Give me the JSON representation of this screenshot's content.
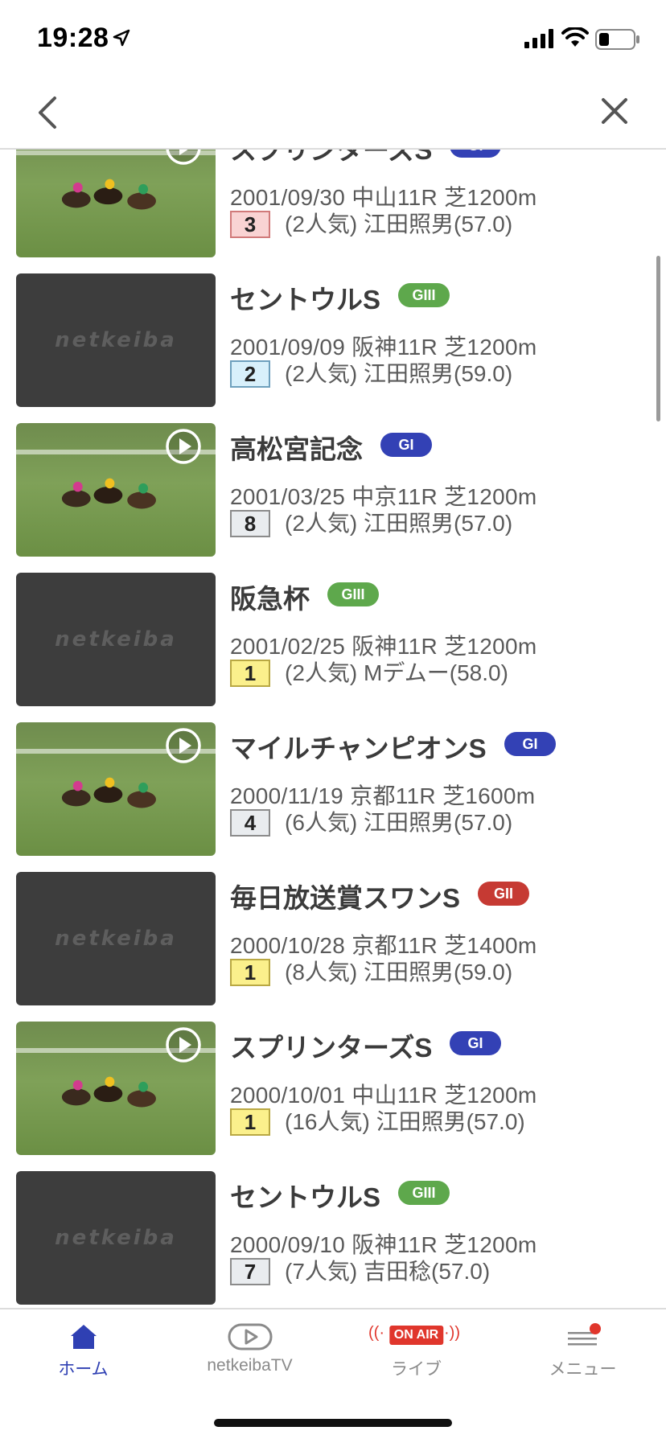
{
  "status_bar": {
    "time": "19:28"
  },
  "nav": {
    "back": "back",
    "close": "close"
  },
  "races": [
    {
      "name": "スプリンターズS",
      "grade": "GI",
      "grade_class": "gi",
      "meta": "2001/09/30 中山11R 芝1200m",
      "finish": "3",
      "finish_class": "third",
      "detail": "(2人気) 江田照男(57.0)",
      "has_video": true
    },
    {
      "name": "セントウルS",
      "grade": "GIII",
      "grade_class": "giii",
      "meta": "2001/09/09 阪神11R 芝1200m",
      "finish": "2",
      "finish_class": "second",
      "detail": "(2人気) 江田照男(59.0)",
      "has_video": false
    },
    {
      "name": "高松宮記念",
      "grade": "GI",
      "grade_class": "gi",
      "meta": "2001/03/25 中京11R 芝1200m",
      "finish": "8",
      "finish_class": "other",
      "detail": "(2人気) 江田照男(57.0)",
      "has_video": true
    },
    {
      "name": "阪急杯",
      "grade": "GIII",
      "grade_class": "giii",
      "meta": "2001/02/25 阪神11R 芝1200m",
      "finish": "1",
      "finish_class": "first",
      "detail": "(2人気) Mデムー(58.0)",
      "has_video": false
    },
    {
      "name": "マイルチャンピオンS",
      "grade": "GI",
      "grade_class": "gi",
      "meta": "2000/11/19 京都11R 芝1600m",
      "finish": "4",
      "finish_class": "other",
      "detail": "(6人気) 江田照男(57.0)",
      "has_video": true
    },
    {
      "name": "毎日放送賞スワンS",
      "grade": "GII",
      "grade_class": "gii",
      "meta": "2000/10/28 京都11R 芝1400m",
      "finish": "1",
      "finish_class": "first",
      "detail": "(8人気) 江田照男(59.0)",
      "has_video": false
    },
    {
      "name": "スプリンターズS",
      "grade": "GI",
      "grade_class": "gi",
      "meta": "2000/10/01 中山11R 芝1200m",
      "finish": "1",
      "finish_class": "first",
      "detail": "(16人気) 江田照男(57.0)",
      "has_video": true
    },
    {
      "name": "セントウルS",
      "grade": "GIII",
      "grade_class": "giii",
      "meta": "2000/09/10 阪神11R 芝1200m",
      "finish": "7",
      "finish_class": "other",
      "detail": "(7人気) 吉田稔(57.0)",
      "has_video": false
    }
  ],
  "placeholder_logo": "netkeiba",
  "tabs": [
    {
      "label": "ホーム",
      "icon": "home-icon",
      "active": true
    },
    {
      "label": "netkeibaTV",
      "icon": "tv-play-icon",
      "active": false
    },
    {
      "label": "ライブ",
      "icon": "on-air-icon",
      "badge": "ON AIR",
      "active": false
    },
    {
      "label": "メニュー",
      "icon": "menu-icon",
      "active": false
    }
  ],
  "colors": {
    "accent": "#2f40b3",
    "gi": "#3341b5",
    "gii": "#c63a33",
    "giii": "#5ea84c",
    "live": "#e0362c"
  }
}
